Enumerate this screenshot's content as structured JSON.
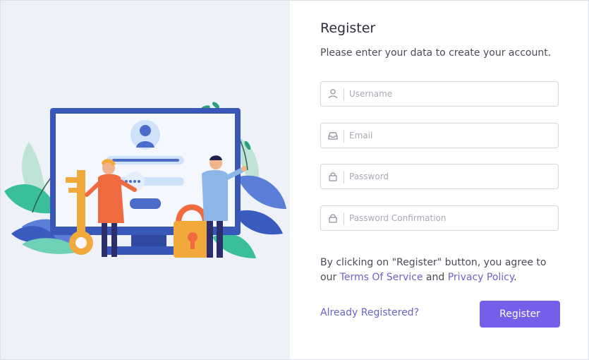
{
  "form": {
    "title": "Register",
    "subtitle": "Please enter your data to create your account.",
    "username_placeholder": "Username",
    "email_placeholder": "Email",
    "password_placeholder": "Password",
    "password_confirmation_placeholder": "Password Confirmation",
    "username_icon": "user-icon",
    "email_icon": "inbox-icon",
    "password_icon": "lock-icon"
  },
  "terms": {
    "prefix": "By clicking on \"Register\" button, you agree to our ",
    "tos_label": "Terms Of Service",
    "and": " and ",
    "privacy_label": "Privacy Policy",
    "suffix": "."
  },
  "actions": {
    "already_registered_label": "Already Registered?",
    "register_label": "Register"
  },
  "colors": {
    "accent": "#7460e8",
    "link": "#6c63c9",
    "panel_bg": "#eef2f8"
  }
}
